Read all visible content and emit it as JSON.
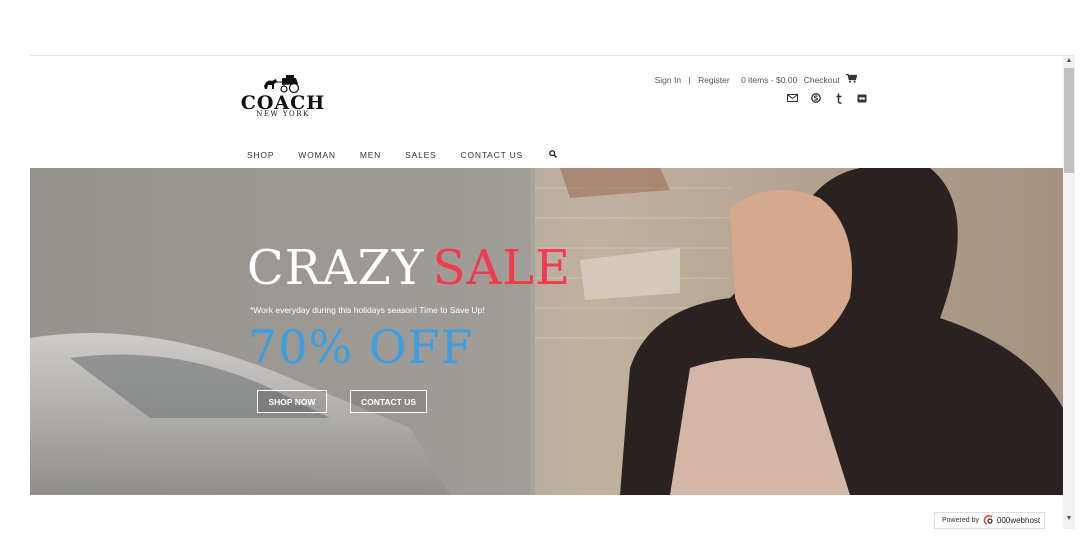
{
  "header": {
    "logo": {
      "word": "COACH",
      "sub": "NEW YORK"
    },
    "links": {
      "sign_in": "Sign In",
      "separator": "|",
      "register": "Register",
      "cart_summary": "0 items - $0.00",
      "checkout": "Checkout"
    },
    "social_icons": [
      "envelope-icon",
      "skype-icon",
      "tumblr-icon",
      "flickr-icon"
    ]
  },
  "nav": {
    "items": [
      "SHOP",
      "WOMAN",
      "MEN",
      "SALES",
      "CONTACT US"
    ],
    "search_icon": "search-icon"
  },
  "hero": {
    "headline_1": "CRAZY",
    "headline_2": "SALE",
    "tagline": "*Work everyday during this holidays season! Time to Save Up!",
    "offer": "70% OFF",
    "buttons": {
      "shop_now": "SHOP NOW",
      "contact_us": "CONTACT US"
    },
    "colors": {
      "headline_accent": "#f23a4c",
      "offer": "#3c9fe1"
    }
  },
  "footer_badge": {
    "label": "Powered by",
    "brand": "000webhost"
  }
}
